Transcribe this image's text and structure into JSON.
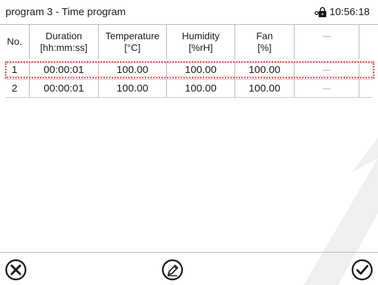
{
  "header": {
    "title": "program 3 - Time program",
    "clock": "10:56:18",
    "lock_icon": "lock-key-icon"
  },
  "table": {
    "columns": [
      {
        "line1": "No.",
        "line2": ""
      },
      {
        "line1": "Duration",
        "line2": "[hh:mm:ss]"
      },
      {
        "line1": "Temperature",
        "line2": "[°C]"
      },
      {
        "line1": "Humidity",
        "line2": "[%rH]"
      },
      {
        "line1": "Fan",
        "line2": "[%]"
      },
      {
        "line1": "---",
        "line2": ""
      },
      {
        "line1": "",
        "line2": ""
      }
    ],
    "rows": [
      {
        "no": "1",
        "duration": "00:00:01",
        "temperature": "100.00",
        "humidity": "100.00",
        "fan": "100.00",
        "extra": "---"
      },
      {
        "no": "2",
        "duration": "00:00:01",
        "temperature": "100.00",
        "humidity": "100.00",
        "fan": "100.00",
        "extra": "---"
      }
    ],
    "selected_row": 1
  },
  "footer": {
    "cancel_icon": "close-circle-icon",
    "edit_icon": "edit-pencil-icon",
    "confirm_icon": "check-circle-icon"
  },
  "colors": {
    "selection_border": "#e05050",
    "grid_line": "#b8b8b8"
  }
}
